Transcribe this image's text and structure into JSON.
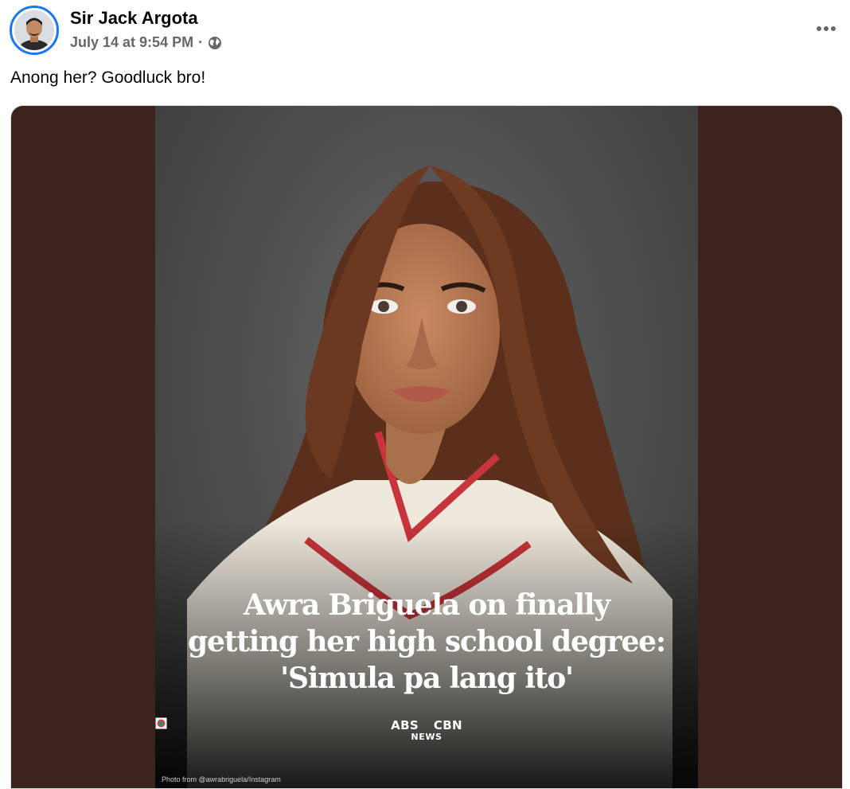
{
  "post": {
    "author": "Sir Jack Argota",
    "timestamp": "July 14 at 9:54 PM",
    "separator": "·",
    "audience_icon": "globe-icon",
    "more_icon": "more-options-icon",
    "caption": "Anong her? Goodluck bro!",
    "accent_color": "#1877f2",
    "frame_color": "#3c231b"
  },
  "media": {
    "headline_line1": "Awra Briguela on finally",
    "headline_line2": "getting her high school degree:",
    "headline_line3": "'Simula pa lang ito'",
    "brand_left": "ABS",
    "brand_right": "CBN",
    "brand_sub": "NEWS",
    "credit": "Photo from @awrabriguela/Instagram"
  }
}
